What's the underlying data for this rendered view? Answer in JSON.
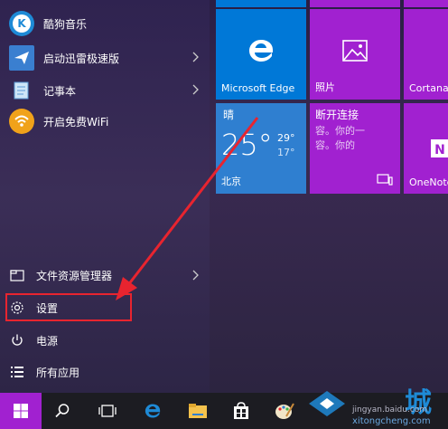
{
  "apps": [
    {
      "label": "酷狗音乐",
      "icon": "kugou-icon",
      "has_submenu": false
    },
    {
      "label": "启动迅雷极速版",
      "icon": "xunlei-icon",
      "has_submenu": true
    },
    {
      "label": "记事本",
      "icon": "notepad-icon",
      "has_submenu": true
    },
    {
      "label": "开启免费WiFi",
      "icon": "wifi-icon",
      "has_submenu": false
    }
  ],
  "system": {
    "explorer_label": "文件资源管理器",
    "settings_label": "设置",
    "power_label": "电源",
    "all_apps_label": "所有应用"
  },
  "tiles": {
    "edge_label": "Microsoft Edge",
    "photos_label": "照片",
    "cortana_label": "Cortana",
    "weather": {
      "condition": "晴",
      "temp": "25°",
      "high": "29°",
      "low": "17°",
      "city": "北京"
    },
    "connect": {
      "title": "断开连接",
      "subtitle": "容。你的一",
      "subtitle2": "容。你的"
    },
    "onenote_label": "OneNote"
  },
  "watermark": {
    "site": "jingyan.baidu.com",
    "url": "xitongcheng.com",
    "brand": "城"
  },
  "colors": {
    "tile_blue": "#0078d7",
    "tile_purple": "#a121d0",
    "highlight_red": "#e8242f"
  }
}
